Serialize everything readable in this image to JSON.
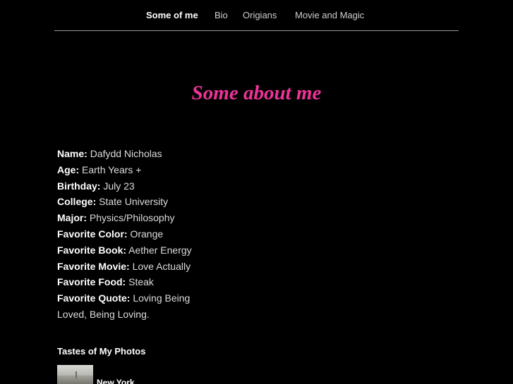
{
  "nav": {
    "items": [
      {
        "label": "Some of me",
        "active": true
      },
      {
        "label": "Bio",
        "active": false
      },
      {
        "label": "Origians",
        "active": false
      },
      {
        "label": "Movie and Magic",
        "active": false
      }
    ]
  },
  "page_title": "Some about me",
  "profile": [
    {
      "label": "Name:",
      "value": "Dafydd Nicholas"
    },
    {
      "label": "Age:",
      "value": "Earth Years +"
    },
    {
      "label": "Birthday:",
      "value": "July 23"
    },
    {
      "label": "College:",
      "value": "State University"
    },
    {
      "label": "Major:",
      "value": "Physics/Philosophy"
    },
    {
      "label": "Favorite Color:",
      "value": "Orange"
    },
    {
      "label": "Favorite Book:",
      "value": "Aether Energy"
    },
    {
      "label": "Favorite Movie:",
      "value": "Love Actually"
    },
    {
      "label": "Favorite Food:",
      "value": "Steak"
    },
    {
      "label": "Favorite Quote:",
      "value": "Loving Being Loved, Being Loving."
    }
  ],
  "photos": {
    "heading": "Tastes of My Photos",
    "items": [
      {
        "caption": "New York"
      }
    ]
  },
  "colors": {
    "background": "#000000",
    "title_accent": "#ee3399",
    "text": "#dcdcdc",
    "nav_rule": "#9a9a9a"
  }
}
